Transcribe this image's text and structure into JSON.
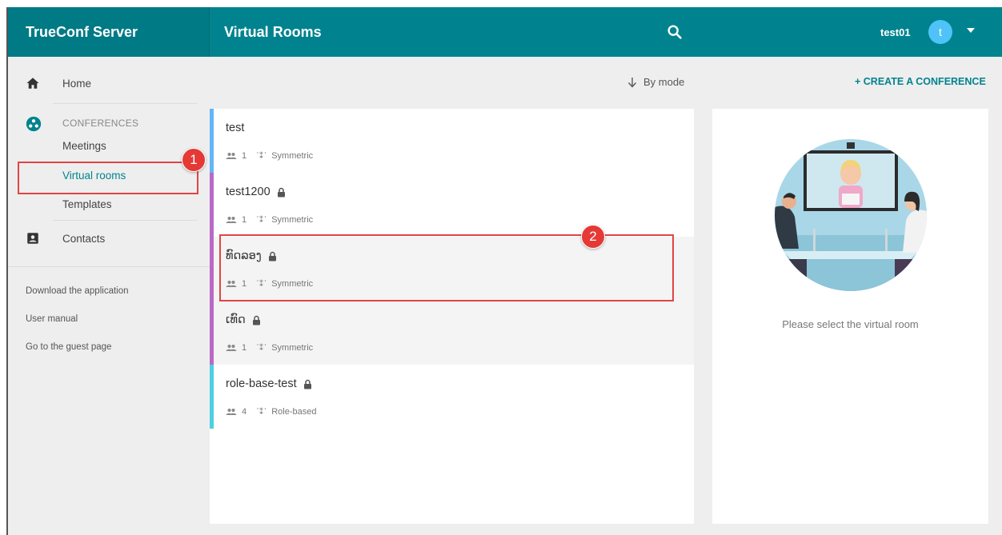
{
  "header": {
    "brand": "TrueConf Server",
    "page_title": "Virtual Rooms",
    "user_name": "test01",
    "avatar_letter": "t"
  },
  "sidebar": {
    "home": "Home",
    "conferences_section": "CONFERENCES",
    "meetings": "Meetings",
    "virtual_rooms": "Virtual rooms",
    "templates": "Templates",
    "contacts": "Contacts",
    "links": [
      "Download the application",
      "User manual",
      "Go to the guest page"
    ]
  },
  "toolbar": {
    "sort_label": "By mode",
    "create_label": "+ CREATE A CONFERENCE"
  },
  "rooms": [
    {
      "name": "test",
      "locked": false,
      "participants": "1",
      "mode": "Symmetric",
      "color": "#64b5f6"
    },
    {
      "name": "test1200",
      "locked": true,
      "participants": "1",
      "mode": "Symmetric",
      "color": "#ba68c8"
    },
    {
      "name": "ທົດລອງ",
      "locked": true,
      "participants": "1",
      "mode": "Symmetric",
      "color": "#ba68c8"
    },
    {
      "name": "ເທົດ",
      "locked": true,
      "participants": "1",
      "mode": "Symmetric",
      "color": "#ba68c8"
    },
    {
      "name": "role-base-test",
      "locked": true,
      "participants": "4",
      "mode": "Role-based",
      "color": "#4dd0e1"
    }
  ],
  "detail": {
    "hint": "Please select the virtual room"
  },
  "annotations": [
    "1",
    "2"
  ],
  "colors": {
    "header": "#00838f",
    "accent": "#00838f",
    "annotation": "#e53935"
  }
}
